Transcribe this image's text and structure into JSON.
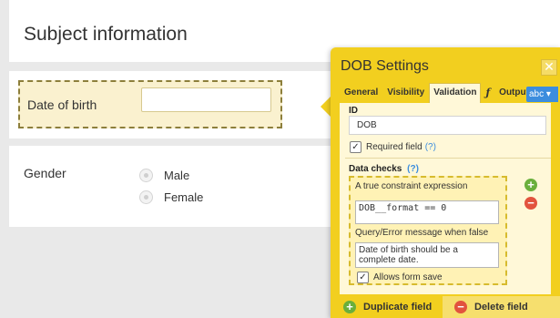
{
  "form": {
    "title": "Subject information",
    "dob_label": "Date of birth",
    "gender_label": "Gender",
    "gender_options": [
      "Male",
      "Female"
    ]
  },
  "panel": {
    "title": "DOB Settings",
    "close_glyph": "✕",
    "tabs": [
      "General",
      "Visibility",
      "Validation",
      "ƒ",
      "Output"
    ],
    "active_tab": "Validation",
    "abc_label": "abc ▾",
    "id_label": "ID",
    "id_value": "DOB",
    "required_label": "Required field",
    "required_help": "(?)",
    "required_checked": true,
    "data_checks_label": "Data checks",
    "data_checks_help": "(?)",
    "constraint_label": "A true constraint expression",
    "constraint_value": "DOB__format == 0",
    "message_label": "Query/Error message when false",
    "message_value": "Date of birth should be a complete date.",
    "allows_save_label": "Allows form save",
    "allows_save_checked": true,
    "add_icon": "+",
    "remove_icon": "−",
    "duplicate_label": "Duplicate field",
    "delete_label": "Delete field"
  },
  "colors": {
    "panel_bg": "#f2cf1f",
    "accent_blue": "#3c8dde",
    "add_green": "#6aaf3b",
    "remove_red": "#e2533e"
  }
}
